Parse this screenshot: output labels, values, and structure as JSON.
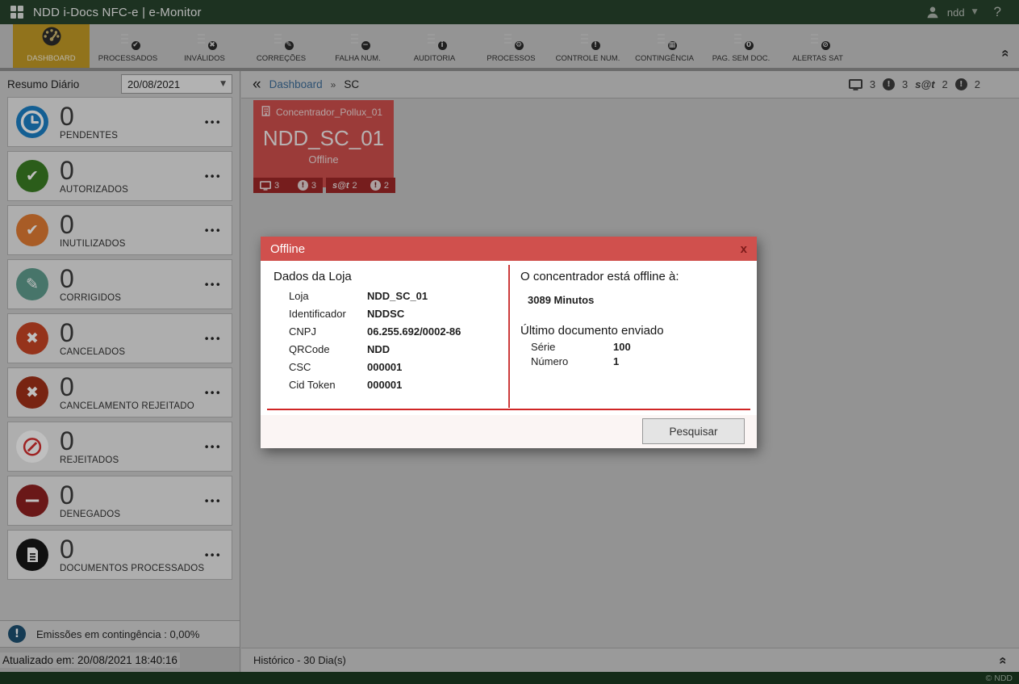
{
  "header": {
    "title": "NDD i-Docs NFC-e | e-Monitor",
    "user": "ndd",
    "help": "?"
  },
  "toolbar": {
    "items": [
      {
        "label": "DASHBOARD",
        "icon": "dashboard-gauge-icon",
        "active": true,
        "glyph": ""
      },
      {
        "label": "PROCESSADOS",
        "icon": "doc-check-icon",
        "glyph": "✔"
      },
      {
        "label": "INVÁLIDOS",
        "icon": "doc-cross-icon",
        "glyph": "✖"
      },
      {
        "label": "CORREÇÕES",
        "icon": "doc-pencil-icon",
        "glyph": "✎"
      },
      {
        "label": "FALHA NUM.",
        "icon": "doc-minus-icon",
        "glyph": "−"
      },
      {
        "label": "AUDITORIA",
        "icon": "doc-info-icon",
        "glyph": "i"
      },
      {
        "label": "PROCESSOS",
        "icon": "doc-gear-icon",
        "glyph": "⚙"
      },
      {
        "label": "CONTROLE NUM.",
        "icon": "doc-alert-icon",
        "glyph": "!"
      },
      {
        "label": "CONTINGÊNCIA",
        "icon": "doc-chart-icon",
        "glyph": "▦"
      },
      {
        "label": "PAG. SEM DOC.",
        "icon": "doc-zero-icon",
        "glyph": "0"
      },
      {
        "label": "ALERTAS SAT",
        "icon": "doc-slash-icon",
        "glyph": "⊘"
      }
    ]
  },
  "sidebar": {
    "title": "Resumo Diário",
    "date_value": "20/08/2021",
    "cards": [
      {
        "count": "0",
        "label": "PENDENTES",
        "icon": "clock-icon",
        "color": "#1b7fc4"
      },
      {
        "count": "0",
        "label": "AUTORIZADOS",
        "icon": "check-circle-icon",
        "color": "#3a7d23",
        "glyph": "✔"
      },
      {
        "count": "0",
        "label": "INUTILIZADOS",
        "icon": "check-warning-circle-icon",
        "color": "#e07b33",
        "glyph": "✔"
      },
      {
        "count": "0",
        "label": "CORRIGIDOS",
        "icon": "pencil-circle-icon",
        "color": "#5f9c8e",
        "glyph": "✎"
      },
      {
        "count": "0",
        "label": "CANCELADOS",
        "icon": "cross-circle-icon",
        "color": "#c74524",
        "glyph": "✖"
      },
      {
        "count": "0",
        "label": "CANCELAMENTO REJEITADO",
        "icon": "cross-circle-icon",
        "color": "#a03018",
        "glyph": "✖"
      },
      {
        "count": "0",
        "label": "REJEITADOS",
        "icon": "prohibited-icon",
        "color": "#ffffff",
        "glyph": "⊘",
        "glyph_color": "#d32f2f"
      },
      {
        "count": "0",
        "label": "DENEGADOS",
        "icon": "minus-circle-icon",
        "color": "#8e2020",
        "glyph": "−"
      },
      {
        "count": "0",
        "label": "DOCUMENTOS PROCESSADOS",
        "icon": "document-circle-icon",
        "color": "#161616"
      }
    ],
    "contingency": {
      "icon": "alert-circle-icon",
      "color": "#1c4f70",
      "glyph": "!",
      "text": "Emissões em contingência : 0,00%"
    },
    "updated": "Atualizado em: 20/08/2021 18:40:16"
  },
  "breadcrumb": {
    "link": "Dashboard",
    "separator": "»",
    "current": "SC",
    "badges": [
      {
        "icon": "monitor-icon",
        "count": "3"
      },
      {
        "icon": "alert-circle-icon",
        "count": "3"
      },
      {
        "icon": "sat-logo",
        "label": "s@t",
        "count": "2"
      },
      {
        "icon": "alert-circle-icon",
        "count": "2"
      }
    ]
  },
  "tile": {
    "icon": "server-icon",
    "group": "Concentrador_Pollux_01",
    "name": "NDD_SC_01",
    "status": "Offline",
    "color": "#cf4f4c",
    "badges_left": [
      {
        "icon": "monitor-icon",
        "count": "3"
      },
      {
        "icon": "alert-circle-icon",
        "count": "3"
      }
    ],
    "badges_right": [
      {
        "icon": "sat-logo",
        "label": "s@t",
        "count": "2"
      },
      {
        "icon": "alert-circle-icon",
        "count": "2"
      }
    ]
  },
  "modal": {
    "title": "Offline",
    "close_label": "x",
    "accent": "#d0504d",
    "store": {
      "heading": "Dados da Loja",
      "fields": [
        {
          "label": "Loja",
          "value": "NDD_SC_01"
        },
        {
          "label": "Identificador",
          "value": "NDDSC"
        },
        {
          "label": "CNPJ",
          "value": "06.255.692/0002-86"
        },
        {
          "label": "QRCode",
          "value": "NDD"
        },
        {
          "label": "CSC",
          "value": "000001"
        },
        {
          "label": "Cid Token",
          "value": "000001"
        }
      ]
    },
    "offline_info": {
      "heading": "O concentrador está offline à:",
      "duration": "3089 Minutos",
      "last_doc_heading": "Último documento enviado",
      "fields": [
        {
          "label": "Série",
          "value": "100"
        },
        {
          "label": "Número",
          "value": "1"
        }
      ]
    },
    "search_button": "Pesquisar"
  },
  "footer": {
    "history": "Histórico - 30 Dia(s)",
    "copyright": "© NDD"
  }
}
